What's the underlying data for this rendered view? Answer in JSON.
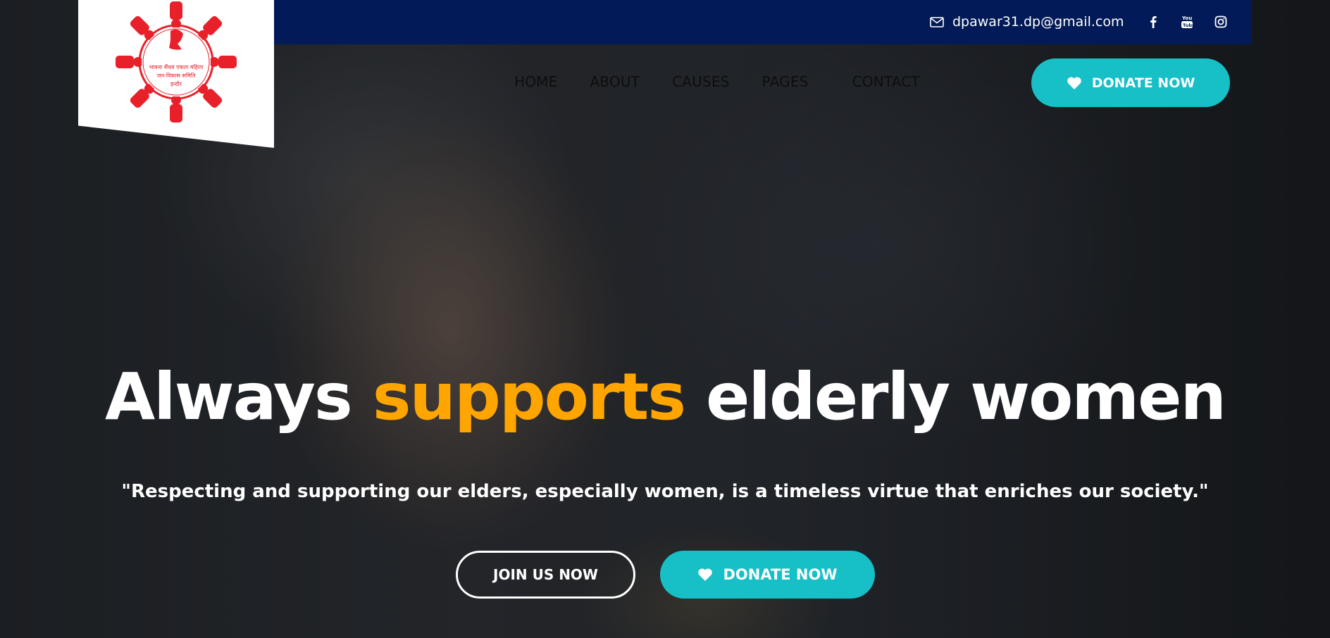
{
  "colors": {
    "topbar": "#021a57",
    "accent_teal": "#17bfc6",
    "headline_accent": "#ffa500",
    "logo_red": "#e8202a"
  },
  "topbar": {
    "email": "dpawar31.dp@gmail.com",
    "email_icon": "mail-icon",
    "socials": [
      "facebook-icon",
      "youtube-icon",
      "instagram-icon"
    ]
  },
  "logo": {
    "text_line1": "भावना सैंधव एकता महिला",
    "text_line2": "जन-विकास समिति",
    "text_line3": "इन्दौर"
  },
  "nav": {
    "items": [
      {
        "label": "HOME"
      },
      {
        "label": "ABOUT"
      },
      {
        "label": "CAUSES"
      },
      {
        "label": "PAGES"
      },
      {
        "label": "CONTACT"
      }
    ],
    "donate_label": "DONATE NOW"
  },
  "hero": {
    "headline_part1": "Always ",
    "headline_accent": "supports",
    "headline_part2": " elderly women",
    "quote": "\"Respecting and supporting our elders, especially women, is a timeless virtue that enriches our society.\"",
    "join_label": "JOIN US NOW",
    "donate_label": "DONATE NOW"
  }
}
